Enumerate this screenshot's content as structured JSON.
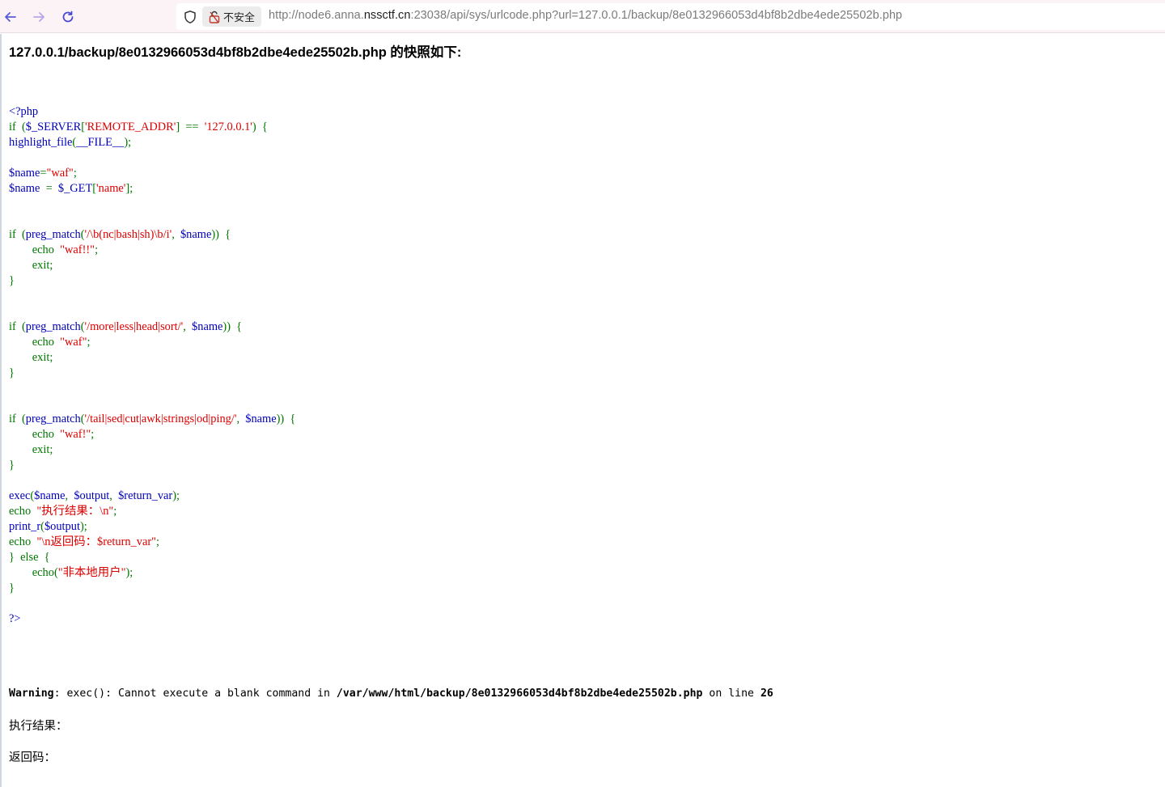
{
  "browser": {
    "url_prefix": "http://node6.anna.",
    "url_host": "nssctf.cn",
    "url_suffix": ":23038/api/sys/urlcode.php?url=127.0.0.1/backup/8e0132966053d4bf8b2dbe4ede25502b.php",
    "insecure_label": "不安全",
    "icons": [
      "back-arrow-icon",
      "forward-arrow-icon",
      "reload-icon",
      "shield-icon",
      "lock-broken-icon"
    ]
  },
  "page": {
    "heading": "127.0.0.1/backup/8e0132966053d4bf8b2dbe4ede25502b.php 的快照如下:",
    "code_lines": [
      [
        {
          "t": "<?php",
          "c": "d"
        }
      ],
      [
        {
          "t": "if  (",
          "c": "k"
        },
        {
          "t": "$_SERVER",
          "c": "d"
        },
        {
          "t": "[",
          "c": "k"
        },
        {
          "t": "'REMOTE_ADDR'",
          "c": "s"
        },
        {
          "t": "]  ==  ",
          "c": "k"
        },
        {
          "t": "'127.0.0.1'",
          "c": "s"
        },
        {
          "t": ")  {",
          "c": "k"
        }
      ],
      [
        {
          "t": "highlight_file",
          "c": "d"
        },
        {
          "t": "(",
          "c": "k"
        },
        {
          "t": "__FILE__",
          "c": "d"
        },
        {
          "t": ");",
          "c": "k"
        }
      ],
      [],
      [
        {
          "t": "$name",
          "c": "d"
        },
        {
          "t": "=",
          "c": "k"
        },
        {
          "t": "\"waf\"",
          "c": "s"
        },
        {
          "t": ";",
          "c": "k"
        }
      ],
      [
        {
          "t": "$name  ",
          "c": "d"
        },
        {
          "t": "=  ",
          "c": "k"
        },
        {
          "t": "$_GET",
          "c": "d"
        },
        {
          "t": "[",
          "c": "k"
        },
        {
          "t": "'name'",
          "c": "s"
        },
        {
          "t": "];",
          "c": "k"
        }
      ],
      [],
      [],
      [
        {
          "t": "if  (",
          "c": "k"
        },
        {
          "t": "preg_match",
          "c": "d"
        },
        {
          "t": "(",
          "c": "k"
        },
        {
          "t": "'/\\b(nc|bash|sh)\\b/i'",
          "c": "s"
        },
        {
          "t": ",  ",
          "c": "k"
        },
        {
          "t": "$name",
          "c": "d"
        },
        {
          "t": "))  {",
          "c": "k"
        }
      ],
      [
        {
          "t": "        echo  ",
          "c": "k"
        },
        {
          "t": "\"waf!!\"",
          "c": "s"
        },
        {
          "t": ";",
          "c": "k"
        }
      ],
      [
        {
          "t": "        exit;",
          "c": "k"
        }
      ],
      [
        {
          "t": "}",
          "c": "k"
        }
      ],
      [],
      [],
      [
        {
          "t": "if  (",
          "c": "k"
        },
        {
          "t": "preg_match",
          "c": "d"
        },
        {
          "t": "(",
          "c": "k"
        },
        {
          "t": "'/more|less|head|sort/'",
          "c": "s"
        },
        {
          "t": ",  ",
          "c": "k"
        },
        {
          "t": "$name",
          "c": "d"
        },
        {
          "t": "))  {",
          "c": "k"
        }
      ],
      [
        {
          "t": "        echo  ",
          "c": "k"
        },
        {
          "t": "\"waf\"",
          "c": "s"
        },
        {
          "t": ";",
          "c": "k"
        }
      ],
      [
        {
          "t": "        exit;",
          "c": "k"
        }
      ],
      [
        {
          "t": "}",
          "c": "k"
        }
      ],
      [],
      [],
      [
        {
          "t": "if  (",
          "c": "k"
        },
        {
          "t": "preg_match",
          "c": "d"
        },
        {
          "t": "(",
          "c": "k"
        },
        {
          "t": "'/tail|sed|cut|awk|strings|od|ping/'",
          "c": "s"
        },
        {
          "t": ",  ",
          "c": "k"
        },
        {
          "t": "$name",
          "c": "d"
        },
        {
          "t": "))  {",
          "c": "k"
        }
      ],
      [
        {
          "t": "        echo  ",
          "c": "k"
        },
        {
          "t": "\"waf!\"",
          "c": "s"
        },
        {
          "t": ";",
          "c": "k"
        }
      ],
      [
        {
          "t": "        exit;",
          "c": "k"
        }
      ],
      [
        {
          "t": "}",
          "c": "k"
        }
      ],
      [],
      [
        {
          "t": "exec",
          "c": "d"
        },
        {
          "t": "(",
          "c": "k"
        },
        {
          "t": "$name",
          "c": "d"
        },
        {
          "t": ",  ",
          "c": "k"
        },
        {
          "t": "$output",
          "c": "d"
        },
        {
          "t": ",  ",
          "c": "k"
        },
        {
          "t": "$return_var",
          "c": "d"
        },
        {
          "t": ");",
          "c": "k"
        }
      ],
      [
        {
          "t": "echo  ",
          "c": "k"
        },
        {
          "t": "\"执行结果：\\n\"",
          "c": "s"
        },
        {
          "t": ";",
          "c": "k"
        }
      ],
      [
        {
          "t": "print_r",
          "c": "d"
        },
        {
          "t": "(",
          "c": "k"
        },
        {
          "t": "$output",
          "c": "d"
        },
        {
          "t": ");",
          "c": "k"
        }
      ],
      [
        {
          "t": "echo  ",
          "c": "k"
        },
        {
          "t": "\"\\n返回码：$return_var\"",
          "c": "s"
        },
        {
          "t": ";",
          "c": "k"
        }
      ],
      [
        {
          "t": "}  else  {",
          "c": "k"
        }
      ],
      [
        {
          "t": "        echo(",
          "c": "k"
        },
        {
          "t": "\"非本地用户\"",
          "c": "s"
        },
        {
          "t": ");",
          "c": "k"
        }
      ],
      [
        {
          "t": "}",
          "c": "k"
        }
      ],
      [],
      [
        {
          "t": "?>",
          "c": "d"
        }
      ]
    ],
    "warning": {
      "label": "Warning",
      "message": ":  exec(): Cannot execute a blank command in ",
      "path": "/var/www/html/backup/8e0132966053d4bf8b2dbe4ede25502b.php",
      "on_line": " on line ",
      "line": "26"
    },
    "result_label": "执行结果：",
    "return_label": "返回码："
  },
  "colors": {
    "keyword": "#007700",
    "string": "#dd0000",
    "default": "#0000bb"
  }
}
